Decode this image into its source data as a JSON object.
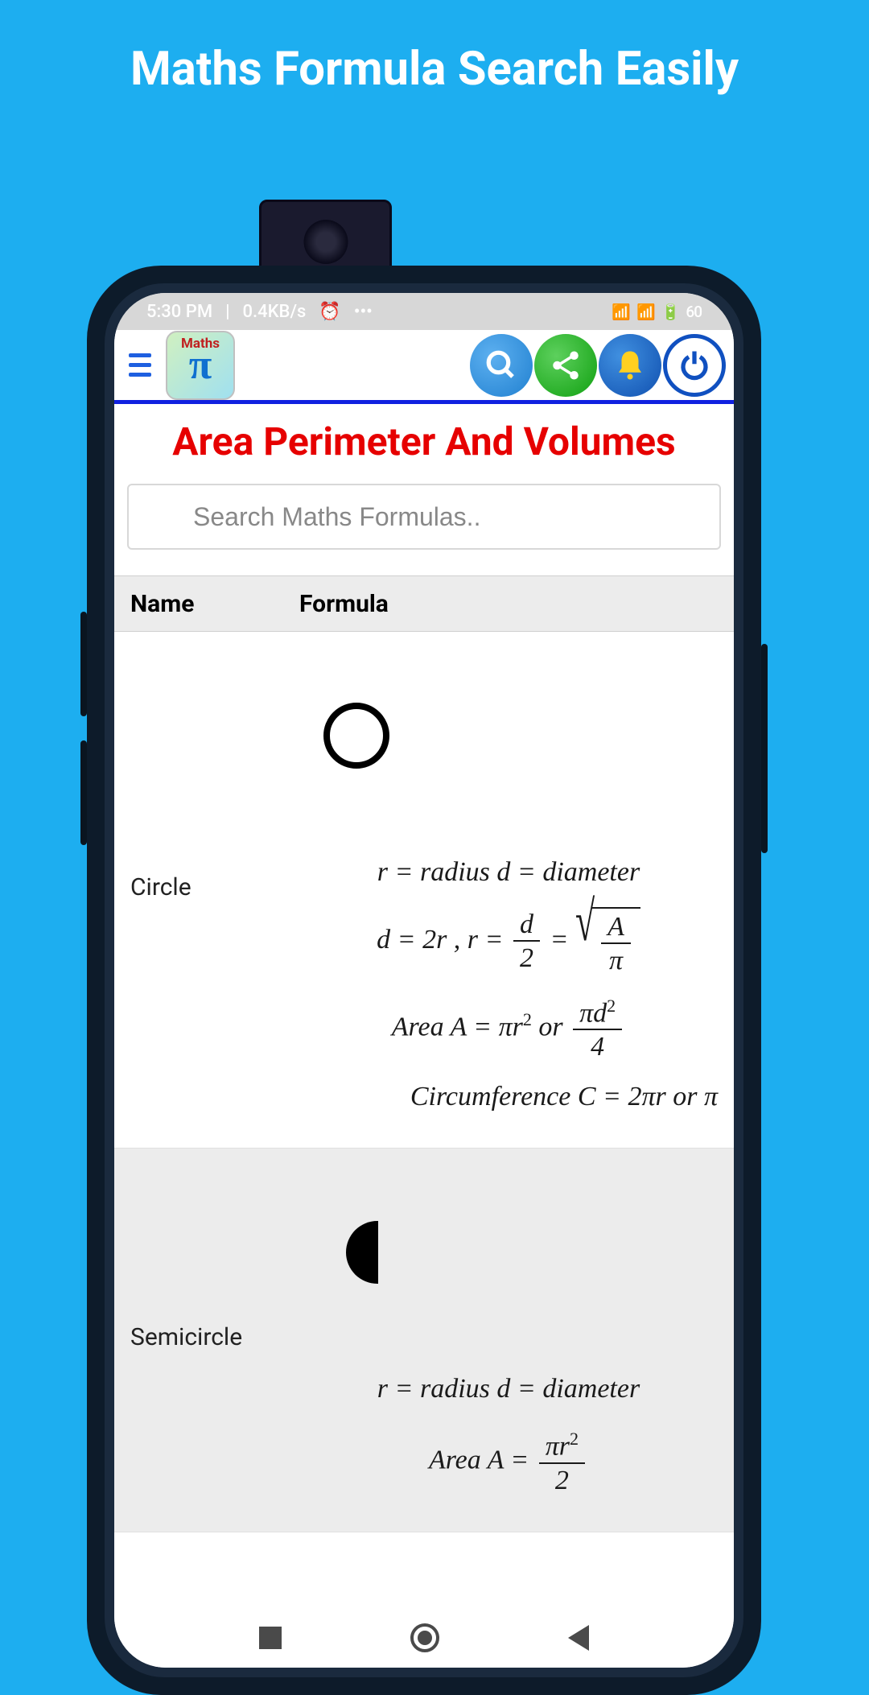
{
  "hero_title": "Maths Formula Search Easily",
  "status": {
    "time": "5:30 PM",
    "net": "0.4KB/s",
    "right": "60"
  },
  "page_title": "Area Perimeter And Volumes",
  "search": {
    "placeholder": "Search Maths Formulas.."
  },
  "table": {
    "col_name": "Name",
    "col_formula": "Formula",
    "rows": [
      {
        "name": "Circle",
        "shape": "circle",
        "formulas": {
          "line1_r": "r",
          "line1_eq": " = ",
          "line1_radius": "radius d",
          "line1_diameter": "diameter",
          "line2_d2r": "d = 2r , r = ",
          "line2_num_d": "d",
          "line2_den_2": "2",
          "line2_num_A": "A",
          "line2_den_pi": "π",
          "line3_area": "Area A = πr",
          "line3_or": " or ",
          "line3_num": "πd",
          "line3_den": "4",
          "line4": "Circumference C = 2πr or π"
        }
      },
      {
        "name": "Semicircle",
        "shape": "semicircle",
        "formulas": {
          "line1_r": "r",
          "line1_eq": " = ",
          "line1_radius": "radius d",
          "line1_diameter": "diameter",
          "line2_area": "Area A = ",
          "line2_num": "πr",
          "line2_den": "2"
        }
      }
    ]
  }
}
